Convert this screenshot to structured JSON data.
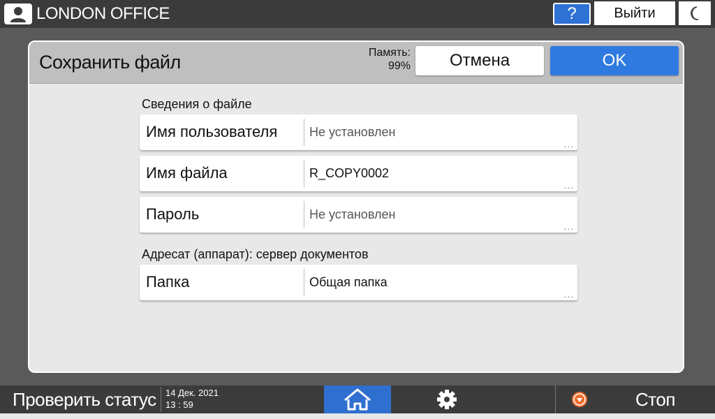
{
  "topbar": {
    "office_name": "LONDON OFFICE",
    "help_label": "?",
    "logout_label": "Выйти",
    "user_icon": "user-icon",
    "energy_icon": "moon-icon"
  },
  "dialog": {
    "title": "Сохранить файл",
    "memory_label": "Память:",
    "memory_value": "99%",
    "cancel_label": "Отмена",
    "ok_label": "OK"
  },
  "file_info": {
    "section_label": "Сведения о файле",
    "fields": [
      {
        "label": "Имя пользователя",
        "value": "Не установлен"
      },
      {
        "label": "Имя файла",
        "value": "R_COPY0002"
      },
      {
        "label": "Пароль",
        "value": "Не установлен"
      }
    ]
  },
  "destination": {
    "section_label": "Адресат (аппарат): сервер документов",
    "fields": [
      {
        "label": "Папка",
        "value": "Общая папка"
      }
    ]
  },
  "more_indicator": "...",
  "bottombar": {
    "status_label": "Проверить статус",
    "date": "14 Дек. 2021",
    "time": "13 : 59",
    "stop_label": "Стоп",
    "home_icon": "home-icon",
    "settings_icon": "gear-icon",
    "stop_icon": "stop-icon"
  },
  "colors": {
    "accent_blue": "#2f7ae0",
    "bar_dark": "#3b3b3b",
    "stop_orange": "#f06a2a"
  }
}
